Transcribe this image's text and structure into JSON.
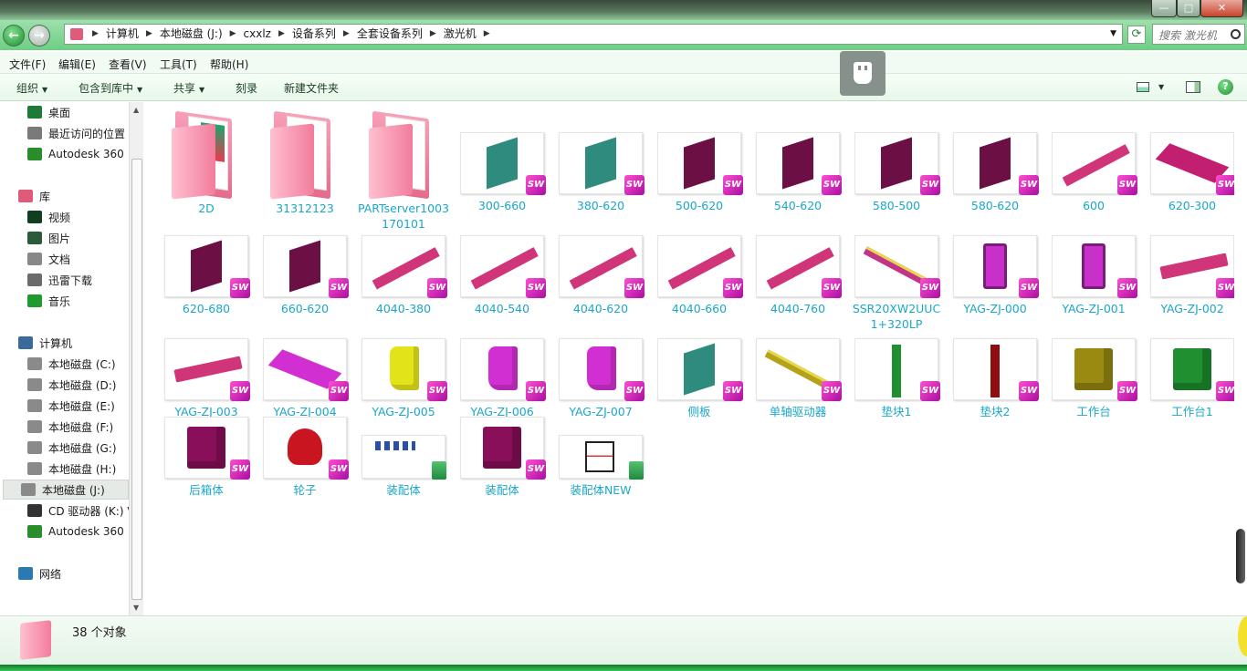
{
  "window": {
    "min": "—",
    "max": "□",
    "close": "✕"
  },
  "nav": {
    "back": "←",
    "forward": "→"
  },
  "address": {
    "crumbs": [
      "计算机",
      "本地磁盘 (J:)",
      "cxxlz",
      "设备系列",
      "全套设备系列",
      "激光机"
    ],
    "separator": "▶"
  },
  "search": {
    "placeholder": "搜索 激光机"
  },
  "menu": [
    "文件(F)",
    "编辑(E)",
    "查看(V)",
    "工具(T)",
    "帮助(H)"
  ],
  "toolbar": {
    "organize": "组织",
    "include": "包含到库中",
    "share": "共享",
    "burn": "刻录",
    "new_folder": "新建文件夹"
  },
  "sidebar": {
    "items": [
      {
        "label": "桌面",
        "icon": "desktop-icon",
        "color": "#1e7a37"
      },
      {
        "label": "最近访问的位置",
        "icon": "recent-icon",
        "color": "#7a7a7a"
      },
      {
        "label": "Autodesk 360",
        "icon": "autodesk-icon",
        "color": "#2a8c2a"
      },
      {
        "label": "库",
        "icon": "library-icon",
        "color": "#e05a79"
      },
      {
        "label": "视频",
        "icon": "video-icon",
        "color": "#0f3f1f"
      },
      {
        "label": "图片",
        "icon": "pictures-icon",
        "color": "#2c5b3a"
      },
      {
        "label": "文档",
        "icon": "documents-icon",
        "color": "#888888"
      },
      {
        "label": "迅雷下载",
        "icon": "download-icon",
        "color": "#6b6b6b"
      },
      {
        "label": "音乐",
        "icon": "music-icon",
        "color": "#1f9a2f"
      },
      {
        "label": "计算机",
        "icon": "computer-icon",
        "color": "#3a6a9a"
      },
      {
        "label": "本地磁盘 (C:)",
        "icon": "drive-icon",
        "color": "#8a8a8a"
      },
      {
        "label": "本地磁盘 (D:)",
        "icon": "drive-icon",
        "color": "#8a8a8a"
      },
      {
        "label": "本地磁盘 (E:)",
        "icon": "drive-icon",
        "color": "#8a8a8a"
      },
      {
        "label": "本地磁盘 (F:)",
        "icon": "drive-icon",
        "color": "#8a8a8a"
      },
      {
        "label": "本地磁盘 (G:)",
        "icon": "drive-icon",
        "color": "#8a8a8a"
      },
      {
        "label": "本地磁盘 (H:)",
        "icon": "drive-icon",
        "color": "#8a8a8a"
      },
      {
        "label": "本地磁盘 (J:)",
        "icon": "drive-icon",
        "color": "#8a8a8a"
      },
      {
        "label": "CD 驱动器 (K:) V",
        "icon": "cd-drive-icon",
        "color": "#333333"
      },
      {
        "label": "Autodesk 360",
        "icon": "autodesk-icon",
        "color": "#2a8c2a"
      },
      {
        "label": "网络",
        "icon": "network-icon",
        "color": "#2a7ab0"
      }
    ]
  },
  "files": [
    {
      "name": "2D",
      "kind": "folder"
    },
    {
      "name": "31312123",
      "kind": "folder"
    },
    {
      "name": "PARTserver1003170101",
      "kind": "folder"
    },
    {
      "name": "300-660",
      "kind": "part",
      "shape": "plate",
      "color": "#2e8b7e"
    },
    {
      "name": "380-620",
      "kind": "part",
      "shape": "plate",
      "color": "#2e8b7e"
    },
    {
      "name": "500-620",
      "kind": "part",
      "shape": "plate",
      "color": "#6b0f45"
    },
    {
      "name": "540-620",
      "kind": "part",
      "shape": "plate",
      "color": "#6b0f45"
    },
    {
      "name": "580-500",
      "kind": "part",
      "shape": "plate",
      "color": "#6b0f45"
    },
    {
      "name": "580-620",
      "kind": "part",
      "shape": "plate",
      "color": "#6b0f45"
    },
    {
      "name": "600",
      "kind": "part",
      "shape": "rail",
      "color": "#d0357a"
    },
    {
      "name": "620-300",
      "kind": "part",
      "shape": "slab",
      "color": "#c21f70"
    },
    {
      "name": "620-680",
      "kind": "part",
      "shape": "plate",
      "color": "#6b0f45"
    },
    {
      "name": "660-620",
      "kind": "part",
      "shape": "plate",
      "color": "#6b0f45"
    },
    {
      "name": "4040-380",
      "kind": "part",
      "shape": "rail",
      "color": "#d0357a"
    },
    {
      "name": "4040-540",
      "kind": "part",
      "shape": "rail",
      "color": "#d0357a"
    },
    {
      "name": "4040-620",
      "kind": "part",
      "shape": "rail",
      "color": "#d0357a"
    },
    {
      "name": "4040-660",
      "kind": "part",
      "shape": "rail",
      "color": "#d0357a"
    },
    {
      "name": "4040-760",
      "kind": "part",
      "shape": "rail",
      "color": "#d0357a"
    },
    {
      "name": "SSR20XW2UUC1+320LP",
      "kind": "part",
      "shape": "guide",
      "color": "#c2338a"
    },
    {
      "name": "YAG-ZJ-000",
      "kind": "part",
      "shape": "bracket",
      "color": "#c92fc9"
    },
    {
      "name": "YAG-ZJ-001",
      "kind": "part",
      "shape": "bracket",
      "color": "#c92fc9"
    },
    {
      "name": "YAG-ZJ-002",
      "kind": "part",
      "shape": "bar",
      "color": "#d0357a"
    },
    {
      "name": "YAG-ZJ-003",
      "kind": "part",
      "shape": "bar",
      "color": "#d0357a"
    },
    {
      "name": "YAG-ZJ-004",
      "kind": "part",
      "shape": "slab",
      "color": "#d22fd2"
    },
    {
      "name": "YAG-ZJ-005",
      "kind": "part",
      "shape": "block",
      "color": "#e3e31a"
    },
    {
      "name": "YAG-ZJ-006",
      "kind": "part",
      "shape": "block",
      "color": "#d22fd2"
    },
    {
      "name": "YAG-ZJ-007",
      "kind": "part",
      "shape": "block",
      "color": "#d22fd2"
    },
    {
      "name": "侧板",
      "kind": "part",
      "shape": "plate",
      "color": "#2e8b7e"
    },
    {
      "name": "单轴驱动器",
      "kind": "part",
      "shape": "guide",
      "color": "#b4a21a"
    },
    {
      "name": "垫块1",
      "kind": "part",
      "shape": "post",
      "color": "#1f8f2f"
    },
    {
      "name": "垫块2",
      "kind": "part",
      "shape": "post",
      "color": "#8f0f10"
    },
    {
      "name": "工作台",
      "kind": "part",
      "shape": "cube",
      "color": "#9a8a12"
    },
    {
      "name": "工作台1",
      "kind": "part",
      "shape": "cube",
      "color": "#1f8f2f"
    },
    {
      "name": "后箱体",
      "kind": "part",
      "shape": "cube",
      "color": "#8a0f5a"
    },
    {
      "name": "轮子",
      "kind": "part",
      "shape": "wheel",
      "color": "#c8151f"
    },
    {
      "name": "装配体",
      "kind": "assembly",
      "shape": "sketch",
      "color": "#2a4fa8"
    },
    {
      "name": "装配体",
      "kind": "part",
      "shape": "cube",
      "color": "#8a0f5a"
    },
    {
      "name": "装配体NEW",
      "kind": "assembly",
      "shape": "drawing",
      "color": "#222222"
    }
  ],
  "status": {
    "count": "38 个对象"
  },
  "badges": {
    "sw": "SW"
  },
  "colors": {
    "accent": "#6ccf83",
    "label": "#1aa7c9"
  }
}
